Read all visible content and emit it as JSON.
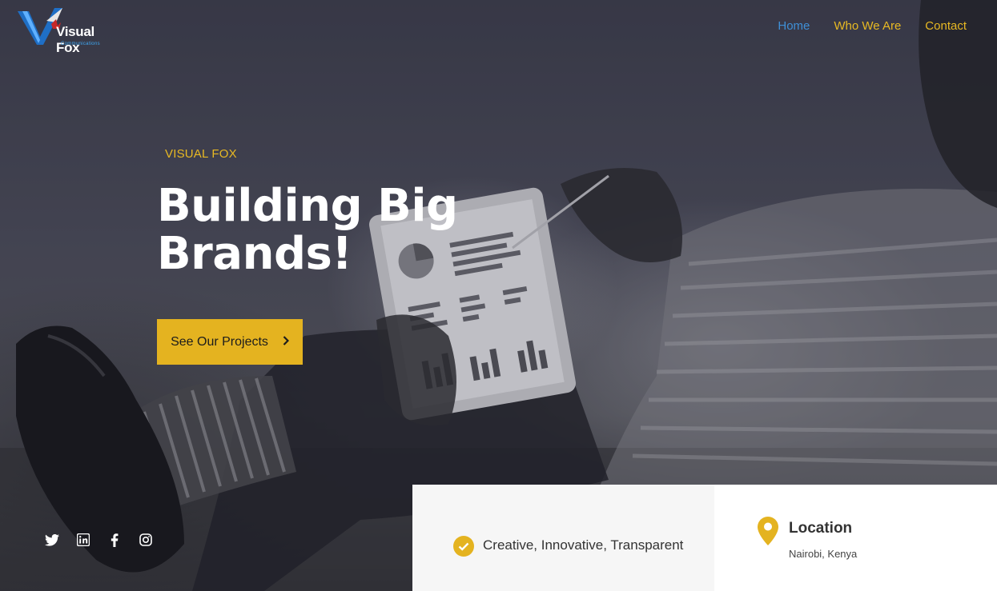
{
  "brand": {
    "logo_text": "Visual Fox",
    "logo_sub": "Communications"
  },
  "nav": {
    "items": [
      {
        "label": "Home",
        "active": true
      },
      {
        "label": "Who We Are",
        "active": false
      },
      {
        "label": "Contact",
        "active": false
      }
    ]
  },
  "hero": {
    "eyebrow": "VISUAL FOX",
    "headline": "Building Big Brands!",
    "cta_label": "See Our Projects"
  },
  "social": [
    "twitter-icon",
    "linkedin-icon",
    "facebook-icon",
    "instagram-icon"
  ],
  "info": {
    "tagline": "Creative, Innovative, Transparent",
    "location_title": "Location",
    "location_value": "Nairobi, Kenya"
  },
  "colors": {
    "accent": "#e4b320",
    "nav_active": "#3f8fd6",
    "nav_link": "#e8b923",
    "hero_overlay": "#3b3c4a"
  }
}
